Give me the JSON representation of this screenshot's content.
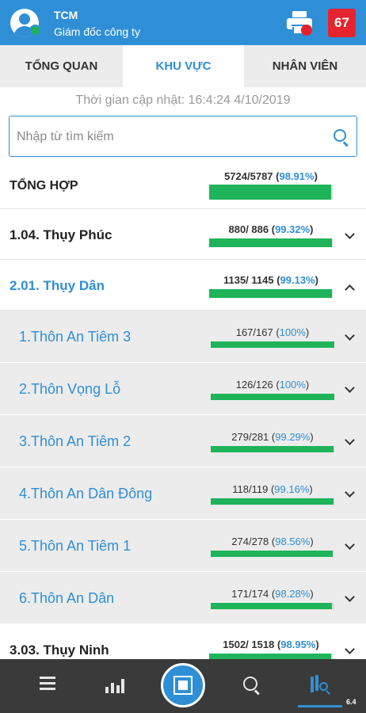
{
  "header": {
    "user_name": "TCM",
    "user_role": "Giám đốc công ty",
    "notification_count": "67",
    "colors": {
      "bar": "#2f8fd6",
      "badge": "#e5242f"
    }
  },
  "tabs": [
    {
      "label": "TỔNG QUAN",
      "active": false
    },
    {
      "label": "KHU VỰC",
      "active": true
    },
    {
      "label": "NHÂN VIÊN",
      "active": false
    }
  ],
  "update_time": "Thời gian cập nhật: 16:4:24  4/10/2019",
  "search": {
    "placeholder": "Nhập từ tìm kiếm",
    "value": ""
  },
  "summary": {
    "label": "TỔNG HỢP",
    "count": "5724/5787",
    "percent": "98.91%",
    "progress": 0.9891
  },
  "areas": [
    {
      "label": "1.04. Thụy Phúc",
      "count": "880/ 886",
      "percent": "99.32%",
      "progress": 0.9932,
      "expanded": false
    },
    {
      "label": "2.01. Thụy Dân",
      "count": "1135/ 1145",
      "percent": "99.13%",
      "progress": 0.9913,
      "expanded": true,
      "villages": [
        {
          "label": "1.Thôn An Tiêm 3",
          "count": "167/167",
          "percent": "100%",
          "progress": 1.0
        },
        {
          "label": "2.Thôn Vọng Lỗ",
          "count": "126/126",
          "percent": "100%",
          "progress": 1.0
        },
        {
          "label": "3.Thôn An Tiêm 2",
          "count": "279/281",
          "percent": "99.29%",
          "progress": 0.9929
        },
        {
          "label": "4.Thôn An Dân Đông",
          "count": "118/119",
          "percent": "99.16%",
          "progress": 0.9916
        },
        {
          "label": "5.Thôn An Tiêm 1",
          "count": "274/278",
          "percent": "98.56%",
          "progress": 0.9856
        },
        {
          "label": "6.Thôn An Dân",
          "count": "171/174",
          "percent": "98.28%",
          "progress": 0.9828
        }
      ]
    },
    {
      "label": "3.03. Thụy Ninh",
      "count": "1502/ 1518",
      "percent": "98.95%",
      "progress": 0.9895,
      "expanded": false
    }
  ],
  "bottom_nav": {
    "items": [
      "list-icon",
      "chart-icon",
      "scan-icon",
      "search-icon",
      "area-map-icon"
    ],
    "active": "area-map-icon",
    "version": "6.4"
  }
}
